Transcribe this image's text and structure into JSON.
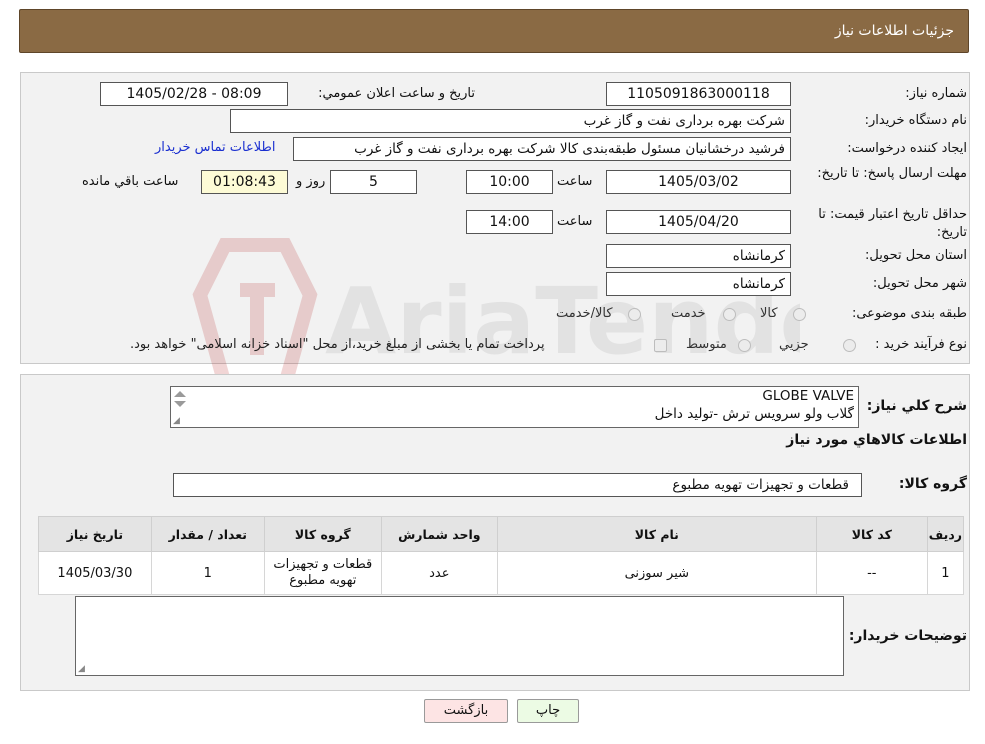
{
  "header": {
    "title": "جزئیات اطلاعات نیاز"
  },
  "form": {
    "need_number_label": "شماره نیاز:",
    "need_number": "1105091863000118",
    "announce_label": "تاریخ و ساعت اعلان عمومي:",
    "announce_value": "1405/02/28 - 08:09",
    "buyer_org_label": "نام دستگاه خریدار:",
    "buyer_org": "شرکت بهره برداری نفت و گاز غرب",
    "creator_label": "ایجاد کننده درخواست:",
    "creator": "فرشید درخشانیان مسئول طبقه‌بندی کالا شرکت بهره برداری نفت و گاز غرب",
    "contact_link": "اطلاعات تماس خریدار",
    "deadline_label": "مهلت ارسال پاسخ: تا تاریخ:",
    "deadline_date": "1405/03/02",
    "time_label": "ساعت",
    "deadline_time": "10:00",
    "days_value": "5",
    "days_label": "روز و",
    "remaining_time": "01:08:43",
    "remaining_label": "ساعت باقي مانده",
    "validity_label": "حداقل تاریخ اعتبار قیمت: تا تاریخ:",
    "validity_date": "1405/04/20",
    "validity_time": "14:00",
    "province_label": "استان محل تحویل:",
    "province": "کرمانشاه",
    "city_label": "شهر محل تحویل:",
    "city": "کرمانشاه",
    "category_label": "طبقه بندی موضوعی:",
    "category_options": [
      "کالا",
      "خدمت",
      "کالا/خدمت"
    ],
    "process_label": "نوع فرآیند خرید :",
    "process_options": [
      "جزیي",
      "متوسط"
    ],
    "process_note": "پرداخت تمام یا بخشی از مبلغ خرید،از محل \"اسناد خزانه اسلامی\" خواهد بود."
  },
  "summary": {
    "label": "شرح کلي نیاز:",
    "line1": "GLOBE VALVE",
    "line2": "گلاب ولو سرویس ترش -تولید داخل",
    "items_heading": "اطلاعات کالاهاي مورد نیاز",
    "group_label": "گروه کالا:",
    "group_value": "قطعات و تجهیزات تهویه مطبوع"
  },
  "table": {
    "headers": [
      "ردیف",
      "کد کالا",
      "نام کالا",
      "واحد شمارش",
      "گروه کالا",
      "تعداد / مقدار",
      "تاریخ نیاز"
    ],
    "rows": [
      [
        "1",
        "--",
        "شیر سوزنی",
        "عدد",
        "قطعات و تجهیزات تهویه مطبوع",
        "1",
        "1405/03/30"
      ]
    ]
  },
  "notes": {
    "label": "توضیحات خریدار:",
    "value": ""
  },
  "buttons": {
    "print": "چاپ",
    "back": "بازگشت"
  },
  "watermark": {
    "text": "AriaTender.neT"
  },
  "colors": {
    "header_bg": "#8a6a44",
    "link": "#1a2fd0",
    "remaining_bg": "#fdfbd6",
    "back_btn": "#fde4e4",
    "print_btn": "#ecfbe4"
  }
}
